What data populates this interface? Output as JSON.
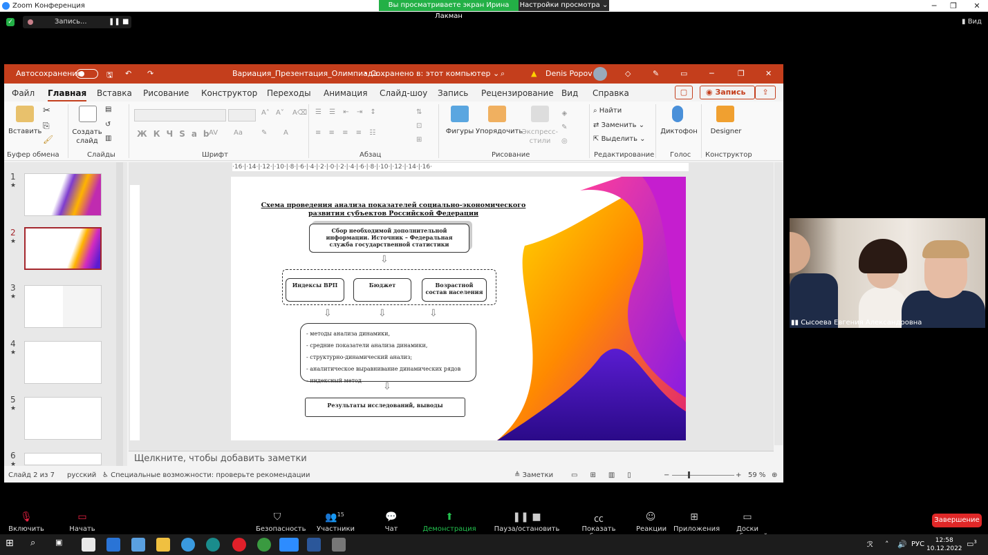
{
  "zoom": {
    "title": "Zoom Конференция",
    "share_banner": "Вы просматриваете экран Ирина Лакман",
    "view_options": "Настройки просмотра ⌄",
    "record_label": "Запись...",
    "view_label": "Вид",
    "participant_name": "Сысоева Евгения Александровна",
    "participants_count": "15",
    "toolbar": {
      "audio": "Включить звук",
      "video": "Начать видео",
      "security": "Безопасность",
      "participants": "Участники",
      "chat": "Чат",
      "share": "Демонстрация экрана",
      "pause_record": "Пауза/остановить запись",
      "captions": "Показать субтитры",
      "reactions": "Реакции",
      "apps": "Приложения",
      "whiteboards": "Доски сообщений",
      "end": "Завершение"
    }
  },
  "ppt": {
    "autosave": "Автосохранение",
    "filename": "Вариация_Презентация_Олимпиада....",
    "saved": "• Сохранено в: этот компьютер ⌄",
    "user": "Denis Popov",
    "menu": [
      "Файл",
      "Главная",
      "Вставка",
      "Рисование",
      "Конструктор",
      "Переходы",
      "Анимация",
      "Слайд-шоу",
      "Запись",
      "Рецензирование",
      "Вид",
      "Справка"
    ],
    "record_btn": "Запись",
    "ribbon": {
      "paste": "Вставить",
      "create_slide": "Создать слайд",
      "shapes": "Фигуры",
      "arrange": "Упорядочить",
      "express": "Экспресс-стили",
      "find": "Найти",
      "replace": "Заменить",
      "select": "Выделить",
      "dictophone": "Диктофон",
      "designer": "Designer",
      "groups": [
        "Буфер обмена",
        "Слайды",
        "Шрифт",
        "Абзац",
        "Рисование",
        "Редактирование",
        "Голос",
        "Конструктор"
      ]
    },
    "ruler": "·16·|·14·|·12·|·10·|·8·|·6·|·4·|·2·|·0·|·2·|·4·|·6·|·8·|·10·|·12·|·14·|·16·",
    "notes_placeholder": "Щелкните, чтобы добавить заметки",
    "status": {
      "slide": "Слайд 2 из 7",
      "lang": "русский",
      "accessibility": "Специальные возможности: проверьте рекомендации",
      "notes": "Заметки",
      "zoom": "59 %"
    },
    "thumbs": [
      "1",
      "2",
      "3",
      "4",
      "5",
      "6"
    ]
  },
  "slide": {
    "title": "Схема проведения анализа показателей социально-экономического развития субъектов Российской Федерации",
    "box1": "Сбор необходимой дополнительной информации. Источник – Федеральная служба государственной статистики",
    "box_a": "Индексы ВРП",
    "box_b": "Бюджет",
    "box_c": "Возрастной состав населения",
    "methods": [
      "- методы анализа динамики,",
      "-  средние показатели анализа динамики,",
      "- структурно-динамический анализ;",
      "- аналитическое выравнивание динамических рядов",
      "- индексный метод"
    ],
    "results": "Результаты исследований, выводы"
  },
  "taskbar": {
    "lang": "РУС",
    "time": "12:58",
    "date": "10.12.2022",
    "notif": "3"
  }
}
